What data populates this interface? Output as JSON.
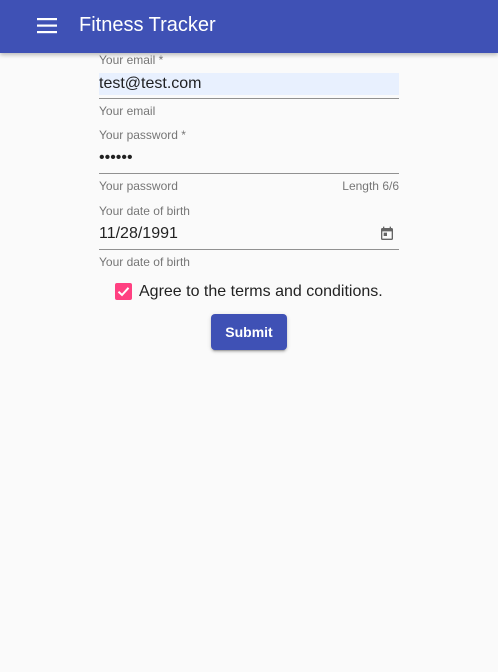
{
  "toolbar": {
    "title": "Fitness Tracker",
    "menu_icon": "menu-icon",
    "color": "#3f51b5"
  },
  "form": {
    "email": {
      "label": "Your email *",
      "value": "test@test.com",
      "hint": "Your email"
    },
    "password": {
      "label": "Your password *",
      "value": "••••••",
      "hint": "Your password",
      "counter": "Length 6/6"
    },
    "birthdate": {
      "label": "Your date of birth",
      "value": "11/28/1991",
      "hint": "Your date of birth",
      "icon": "calendar-icon"
    },
    "terms": {
      "label": "Agree to the terms and conditions.",
      "checked": true,
      "color": "#ff4081"
    },
    "submit_label": "Submit"
  }
}
